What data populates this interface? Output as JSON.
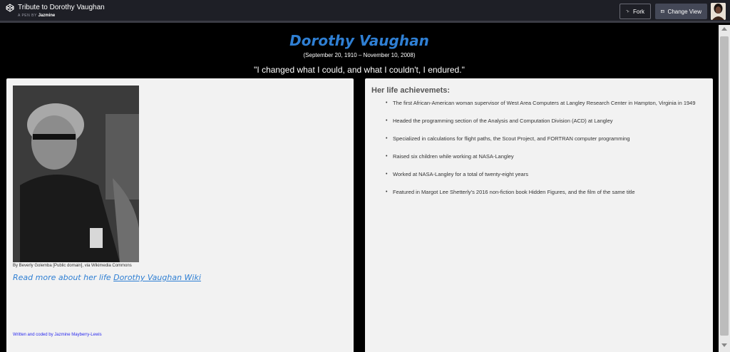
{
  "header": {
    "pen_title": "Tribute to Dorothy Vaughan",
    "pen_by_prefix": "A PEN BY",
    "author": "Jazmine",
    "fork_label": "Fork",
    "change_view_label": "Change View"
  },
  "page": {
    "name": "Dorothy Vaughan",
    "dates": "(September 20, 1910 – November 10, 2008)",
    "quote": "\"I changed what I could, and what I couldn't, I endured.\"",
    "photo_caption": "By Beverly Golemba [Public domain], via Wikimedia Commons",
    "read_more_text": "Read more about her life ",
    "read_more_link": "Dorothy Vaughan Wiki",
    "credit": "Written and coded by Jazmine Mayberry-Lewis",
    "achievements_heading": "Her life achievemets:",
    "achievements": [
      "The first African-American woman supervisor of West Area Computers at Langley Research Center in Hampton, Virginia in 1949",
      "Headed the programming section of the Analysis and Computation Division (ACD) at Langley",
      "Specialized in calculations for flight paths, the Scout Project, and FORTRAN computer programming",
      "Raised six children while working at NASA-Langley",
      "Worked at NASA-Langley for a total of twenty-eight years",
      "Featured in Margot Lee Shetterly's 2016 non-fiction book Hidden Figures, and the film of the same title"
    ]
  },
  "colors": {
    "accent_blue": "#2f7fd3",
    "topbar_bg": "#1e1f26",
    "card_bg": "#f2f2f2"
  }
}
